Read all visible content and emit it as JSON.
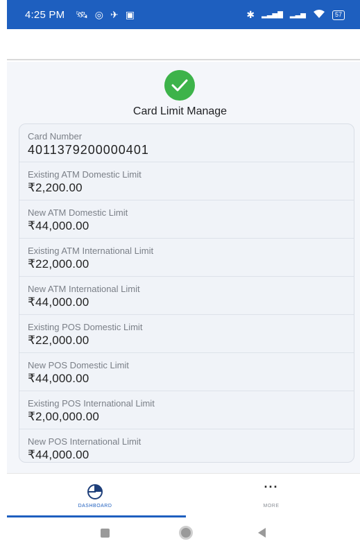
{
  "status_bar": {
    "time": "4:25 PM",
    "left_icons": [
      "🛰",
      "◎",
      "✈",
      "▣"
    ],
    "right_icons": [
      "✱",
      "▂▃▅▇",
      "▂▃▅",
      "wifi-icon"
    ],
    "battery": "57"
  },
  "page": {
    "title": "Card Limit Manage",
    "success_color": "#3db34a"
  },
  "details": [
    {
      "label": "Card Number",
      "value": "4011379200000401"
    },
    {
      "label": "Existing ATM Domestic Limit",
      "value": "₹2,200.00"
    },
    {
      "label": "New ATM Domestic Limit",
      "value": "₹44,000.00"
    },
    {
      "label": "Existing ATM International Limit",
      "value": "₹22,000.00"
    },
    {
      "label": "New ATM International Limit",
      "value": "₹44,000.00"
    },
    {
      "label": "Existing POS Domestic Limit",
      "value": "₹22,000.00"
    },
    {
      "label": "New POS Domestic Limit",
      "value": "₹44,000.00"
    },
    {
      "label": "Existing POS International Limit",
      "value": "₹2,00,000.00"
    },
    {
      "label": "New POS International Limit",
      "value": "₹44,000.00"
    }
  ],
  "bottom_nav": {
    "dashboard_label": "DASHBOARD",
    "more_label": "MORE",
    "active": "DASHBOARD",
    "accent": "#1e5fbf"
  }
}
